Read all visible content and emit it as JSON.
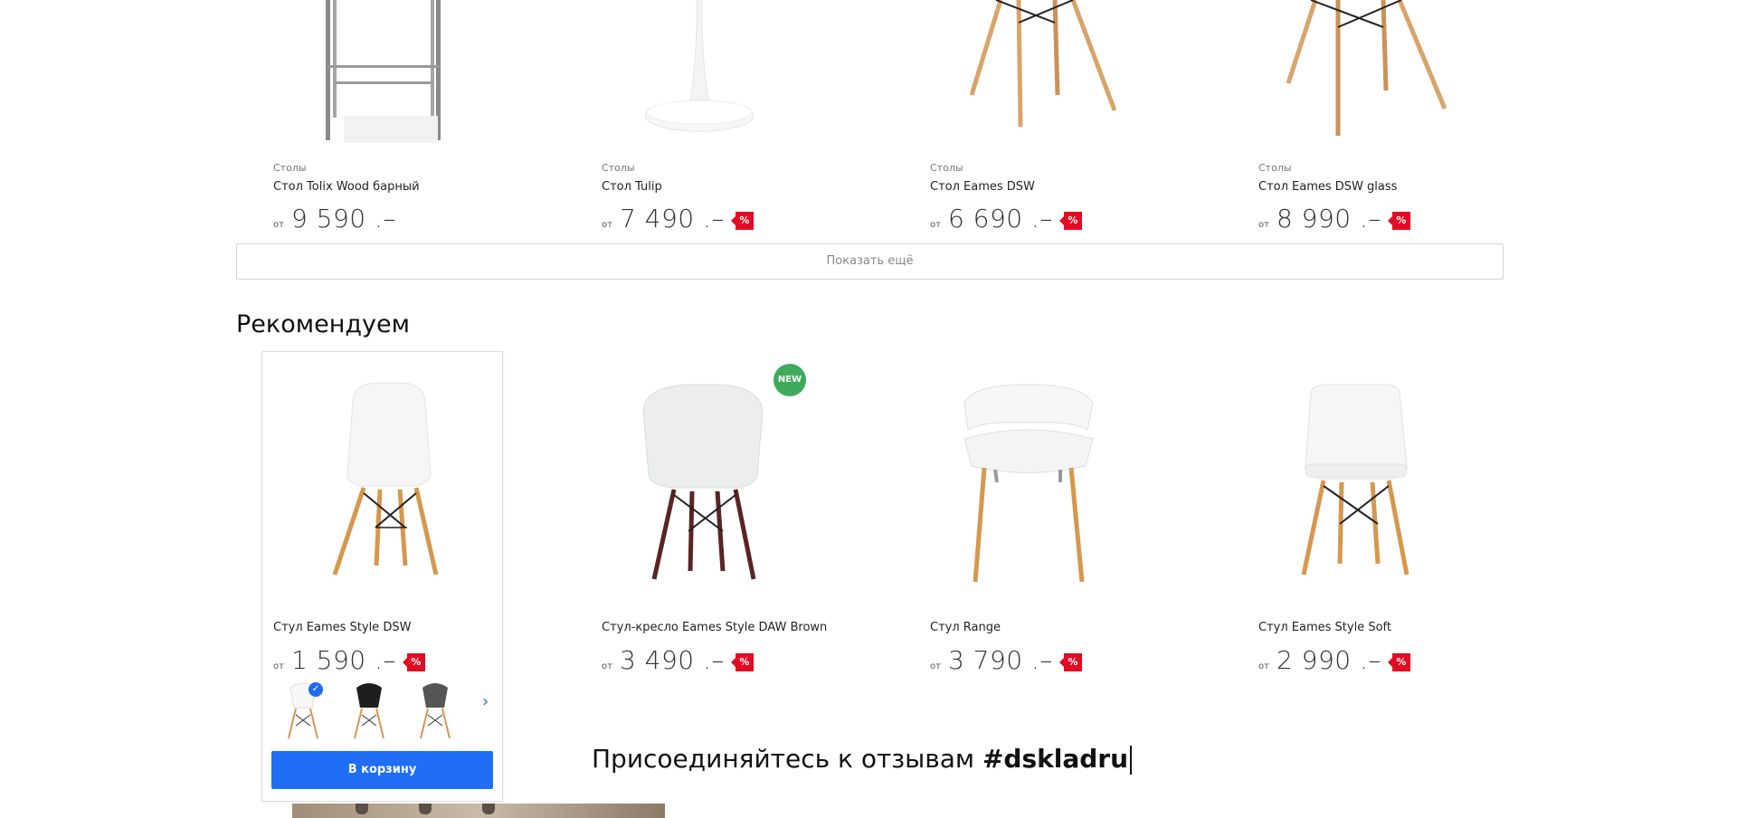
{
  "top_products": [
    {
      "category": "Столы",
      "name": "Стол Tolix Wood барный",
      "price_prefix": "от",
      "price": "9 590 .–",
      "sale_badge": null
    },
    {
      "category": "Столы",
      "name": "Стол Tulip",
      "price_prefix": "от",
      "price": "7 490 .–",
      "sale_badge": "%"
    },
    {
      "category": "Столы",
      "name": "Стол Eames DSW",
      "price_prefix": "от",
      "price": "6 690 .–",
      "sale_badge": "%"
    },
    {
      "category": "Столы",
      "name": "Стол Eames DSW glass",
      "price_prefix": "от",
      "price": "8 990 .–",
      "sale_badge": "%"
    }
  ],
  "show_more_label": "Показать ещё",
  "recommend": {
    "title": "Рекомендуем",
    "products": [
      {
        "name": "Стул Eames Style DSW",
        "price_prefix": "от",
        "price": "1 590 .–",
        "sale_badge": "%"
      },
      {
        "name": "Стул-кресло Eames Style DAW Brown",
        "price_prefix": "от",
        "price": "3 490 .–",
        "sale_badge": "%",
        "badge": "NEW"
      },
      {
        "name": "Стул Range",
        "price_prefix": "от",
        "price": "3 790 .–",
        "sale_badge": "%"
      },
      {
        "name": "Стул Eames Style Soft",
        "price_prefix": "от",
        "price": "2 990 .–",
        "sale_badge": "%"
      }
    ],
    "swatches": [
      "white",
      "black",
      "gray"
    ],
    "add_to_cart_label": "В корзину"
  },
  "join": {
    "text": "Присоединяйтесь к отзывам",
    "hashtag": "#dskladru"
  },
  "colors": {
    "accent_blue": "#1f6ef5",
    "sale_red": "#e30b24",
    "new_green": "#3dab5b"
  }
}
